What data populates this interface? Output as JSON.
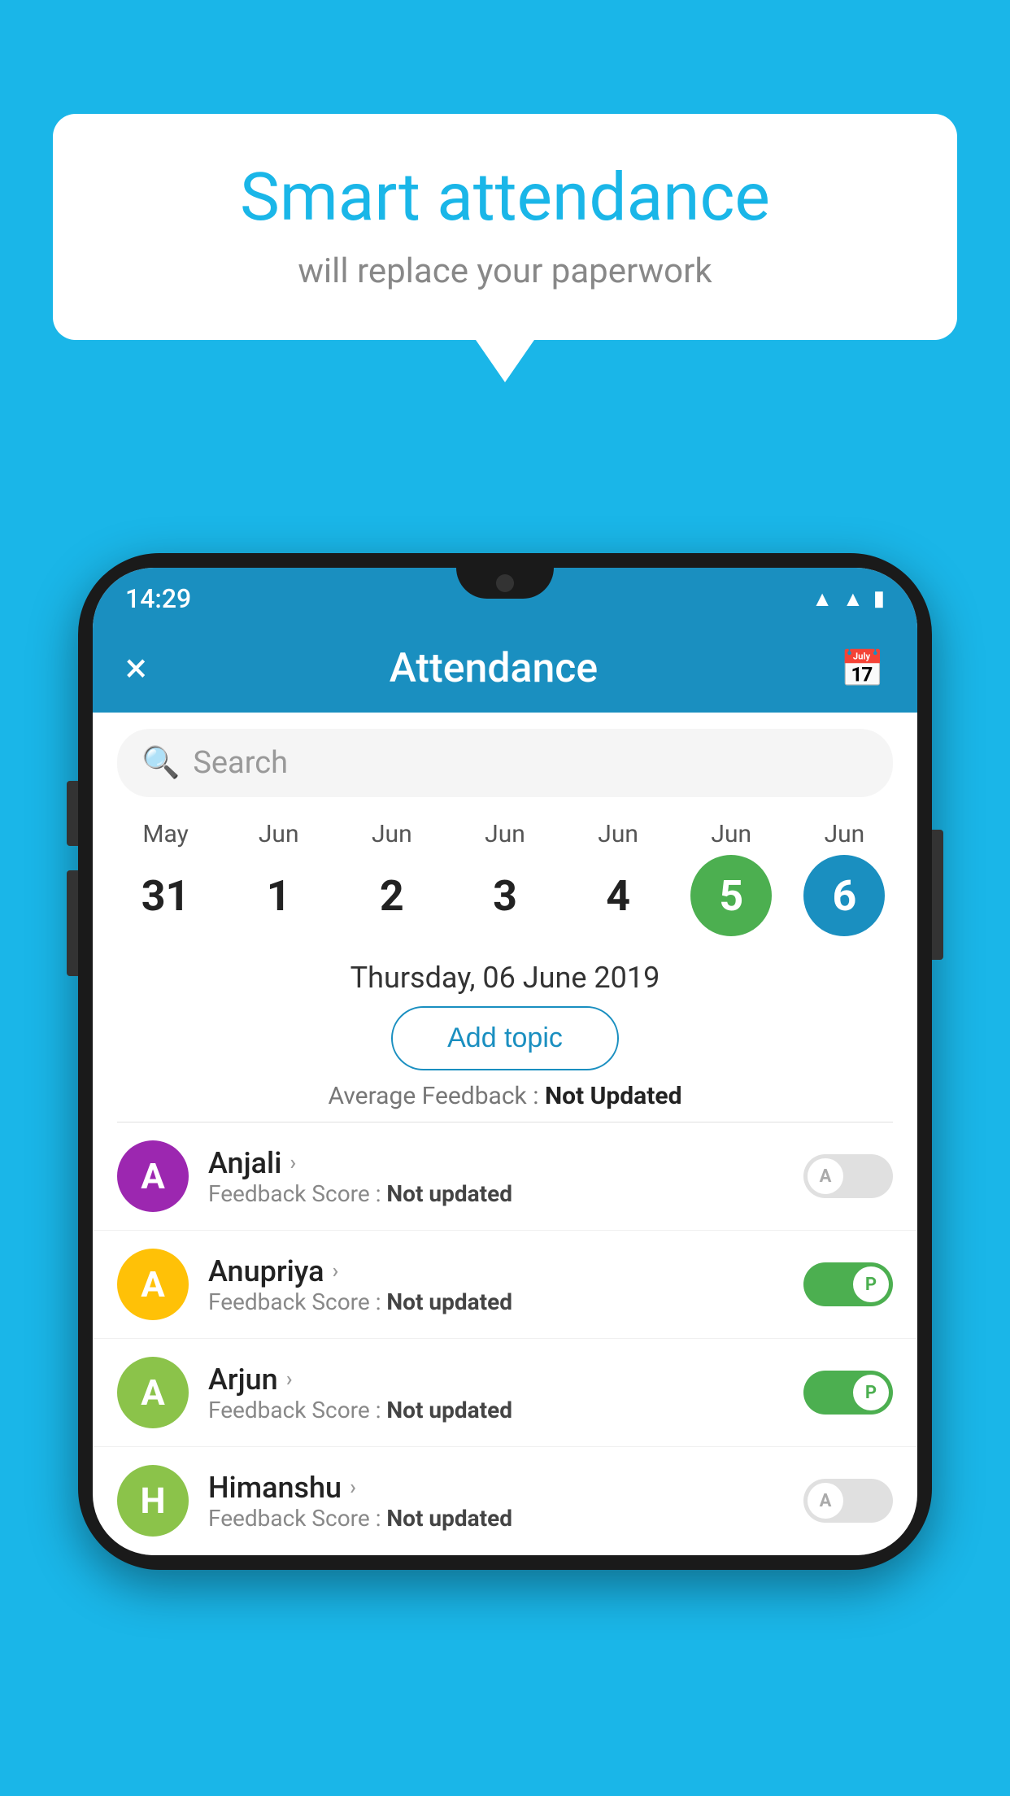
{
  "background_color": "#1ab6e8",
  "speech_bubble": {
    "title": "Smart attendance",
    "subtitle": "will replace your paperwork"
  },
  "status_bar": {
    "time": "14:29",
    "icons": [
      "wifi",
      "signal",
      "battery"
    ]
  },
  "app_bar": {
    "title": "Attendance",
    "close_label": "×",
    "calendar_icon": "🗓"
  },
  "search": {
    "placeholder": "Search"
  },
  "calendar": {
    "days": [
      {
        "month": "May",
        "day": "31",
        "state": "normal"
      },
      {
        "month": "Jun",
        "day": "1",
        "state": "normal"
      },
      {
        "month": "Jun",
        "day": "2",
        "state": "normal"
      },
      {
        "month": "Jun",
        "day": "3",
        "state": "normal"
      },
      {
        "month": "Jun",
        "day": "4",
        "state": "normal"
      },
      {
        "month": "Jun",
        "day": "5",
        "state": "today"
      },
      {
        "month": "Jun",
        "day": "6",
        "state": "selected"
      }
    ]
  },
  "selected_date": "Thursday, 06 June 2019",
  "add_topic_label": "Add topic",
  "avg_feedback": {
    "label": "Average Feedback :",
    "value": "Not Updated"
  },
  "students": [
    {
      "name": "Anjali",
      "avatar_letter": "A",
      "avatar_color": "#9c27b0",
      "feedback_label": "Feedback Score :",
      "feedback_value": "Not updated",
      "toggle": "off",
      "toggle_label": "A"
    },
    {
      "name": "Anupriya",
      "avatar_letter": "A",
      "avatar_color": "#ffc107",
      "feedback_label": "Feedback Score :",
      "feedback_value": "Not updated",
      "toggle": "on",
      "toggle_label": "P"
    },
    {
      "name": "Arjun",
      "avatar_letter": "A",
      "avatar_color": "#8bc34a",
      "feedback_label": "Feedback Score :",
      "feedback_value": "Not updated",
      "toggle": "on",
      "toggle_label": "P"
    },
    {
      "name": "Himanshu",
      "avatar_letter": "H",
      "avatar_color": "#8bc34a",
      "feedback_label": "Feedback Score :",
      "feedback_value": "Not updated",
      "toggle": "off",
      "toggle_label": "A"
    }
  ]
}
